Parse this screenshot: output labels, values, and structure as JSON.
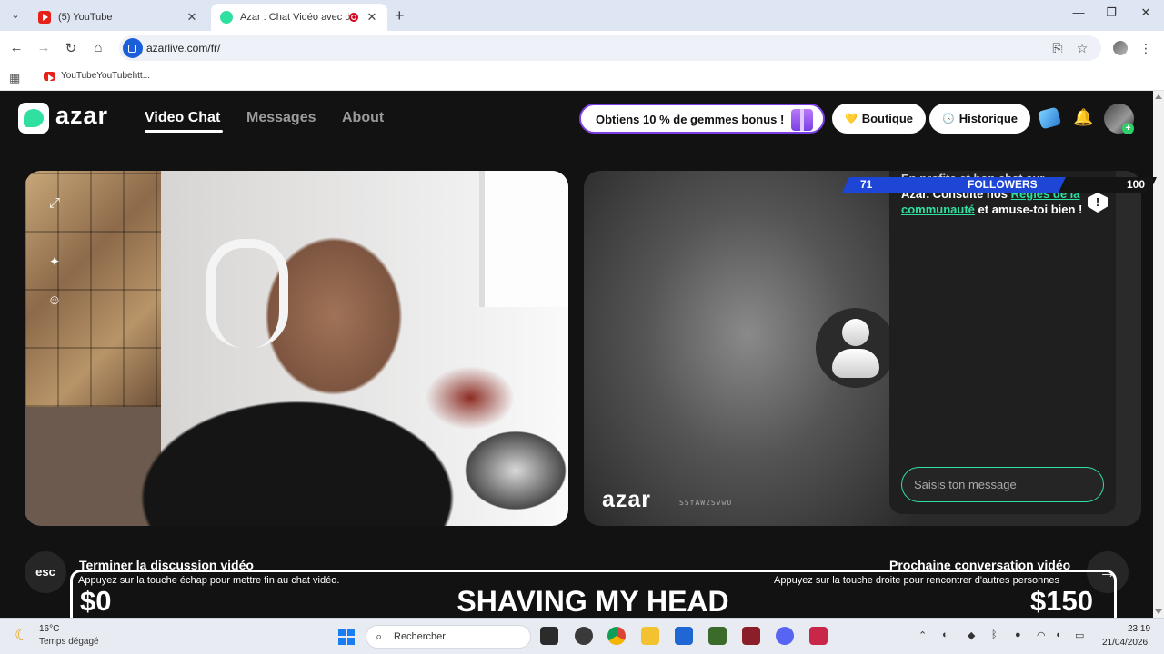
{
  "browser": {
    "tabs": [
      {
        "title": "(5) YouTube",
        "active": false
      },
      {
        "title": "Azar : Chat Vidéo avec de n",
        "active": true
      }
    ],
    "url": "azarlive.com/fr/",
    "bookmark": "YouTubeYouTubehtt..."
  },
  "header": {
    "logo": "azar",
    "nav": [
      "Video Chat",
      "Messages",
      "About"
    ],
    "promo": "Obtiens 10 % de gemmes bonus !",
    "shop": "Boutique",
    "history": "Historique",
    "avatar_badge": "+"
  },
  "video": {
    "watermark": "azar",
    "room_id": "SSfAW2SvwU"
  },
  "chat": {
    "notice_faded": "En profite et bon chat sur",
    "notice_line1": "Azar. Consulte nos ",
    "rules_link": "Règles de la communauté",
    "notice_line2": " et amuse-toi bien !",
    "placeholder": "Saisis ton message"
  },
  "followers_overlay": {
    "current": "71",
    "label": "FOLLOWERS",
    "goal": "100",
    "progress": 0.71
  },
  "controls": {
    "esc_key": "esc",
    "end_title": "Terminer la discussion vidéo",
    "end_sub": "Appuyez sur la touche échap pour mettre fin au chat vidéo.",
    "next_title": "Prochaine conversation vidéo",
    "next_sub": "Appuyez sur la touche droite pour rencontrer d'autres personnes"
  },
  "challenge": {
    "left_amount": "$0",
    "title": "SHAVING MY HEAD",
    "right_amount": "$150"
  },
  "taskbar": {
    "temp": "16°C",
    "weather": "Temps dégagé",
    "search": "Rechercher",
    "time": "23:19",
    "date": "21/04/2026"
  },
  "colors": {
    "accent": "#2fe0a0",
    "promo_border": "#7b3fe4",
    "followers_blue": "#1d46d6"
  }
}
